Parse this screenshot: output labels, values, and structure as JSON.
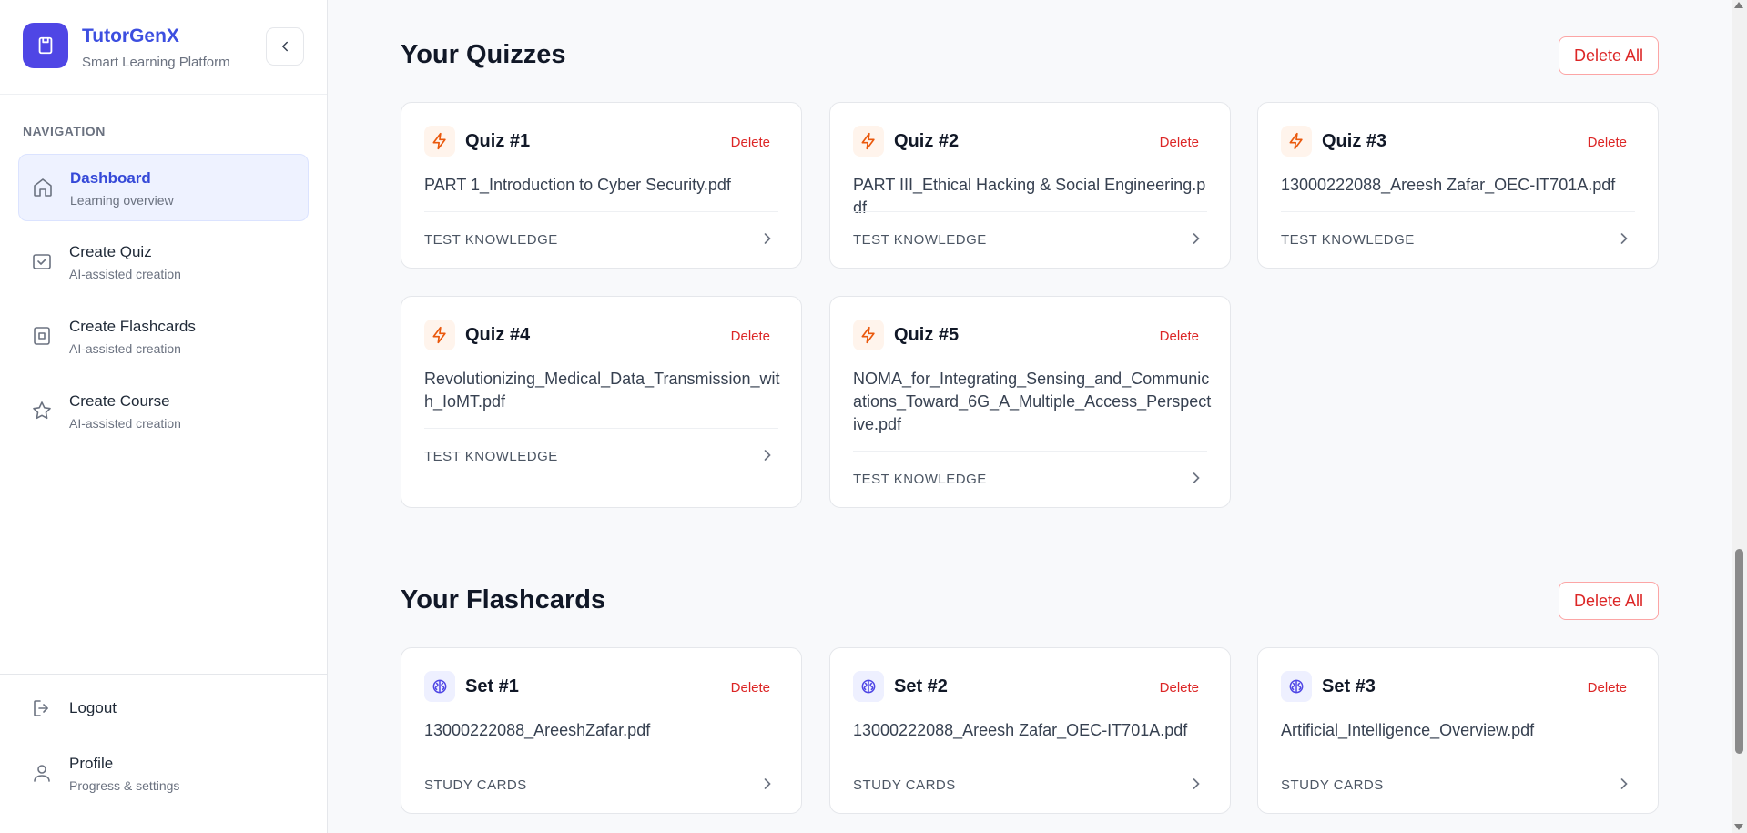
{
  "brand": {
    "title": "TutorGenX",
    "subtitle": "Smart Learning Platform"
  },
  "nav": {
    "heading": "NAVIGATION",
    "items": [
      {
        "label": "Dashboard",
        "sub": "Learning overview",
        "icon": "home-icon"
      },
      {
        "label": "Create Quiz",
        "sub": "AI-assisted creation",
        "icon": "quiz-check-icon"
      },
      {
        "label": "Create Flashcards",
        "sub": "AI-assisted creation",
        "icon": "flashcard-icon"
      },
      {
        "label": "Create Course",
        "sub": "AI-assisted creation",
        "icon": "star-icon"
      }
    ],
    "logout": "Logout",
    "profile": {
      "label": "Profile",
      "sub": "Progress & settings"
    }
  },
  "quizzes": {
    "title": "Your Quizzes",
    "delete_all": "Delete All",
    "delete_label": "Delete",
    "action": "TEST KNOWLEDGE",
    "items": [
      {
        "title": "Quiz #1",
        "file": "PART 1_Introduction to Cyber Security.pdf"
      },
      {
        "title": "Quiz #2",
        "file": "PART III_Ethical Hacking & Social Engineering.pdf"
      },
      {
        "title": "Quiz #3",
        "file": "13000222088_Areesh Zafar_OEC-IT701A.pdf"
      },
      {
        "title": "Quiz #4",
        "file": "Revolutionizing_Medical_Data_Transmission_with_IoMT.pdf"
      },
      {
        "title": "Quiz #5",
        "file": "NOMA_for_Integrating_Sensing_and_Communications_Toward_6G_A_Multiple_Access_Perspective.pdf"
      }
    ]
  },
  "flashcards": {
    "title": "Your Flashcards",
    "delete_all": "Delete All",
    "delete_label": "Delete",
    "action": "STUDY CARDS",
    "items": [
      {
        "title": "Set #1",
        "file": "13000222088_AreeshZafar.pdf"
      },
      {
        "title": "Set #2",
        "file": "13000222088_Areesh Zafar_OEC-IT701A.pdf"
      },
      {
        "title": "Set #3",
        "file": "Artificial_Intelligence_Overview.pdf"
      }
    ]
  },
  "colors": {
    "accent": "#4f46e5",
    "danger": "#dc2626",
    "quiz_icon": "#ea580c",
    "flash_icon": "#4f46e5"
  }
}
